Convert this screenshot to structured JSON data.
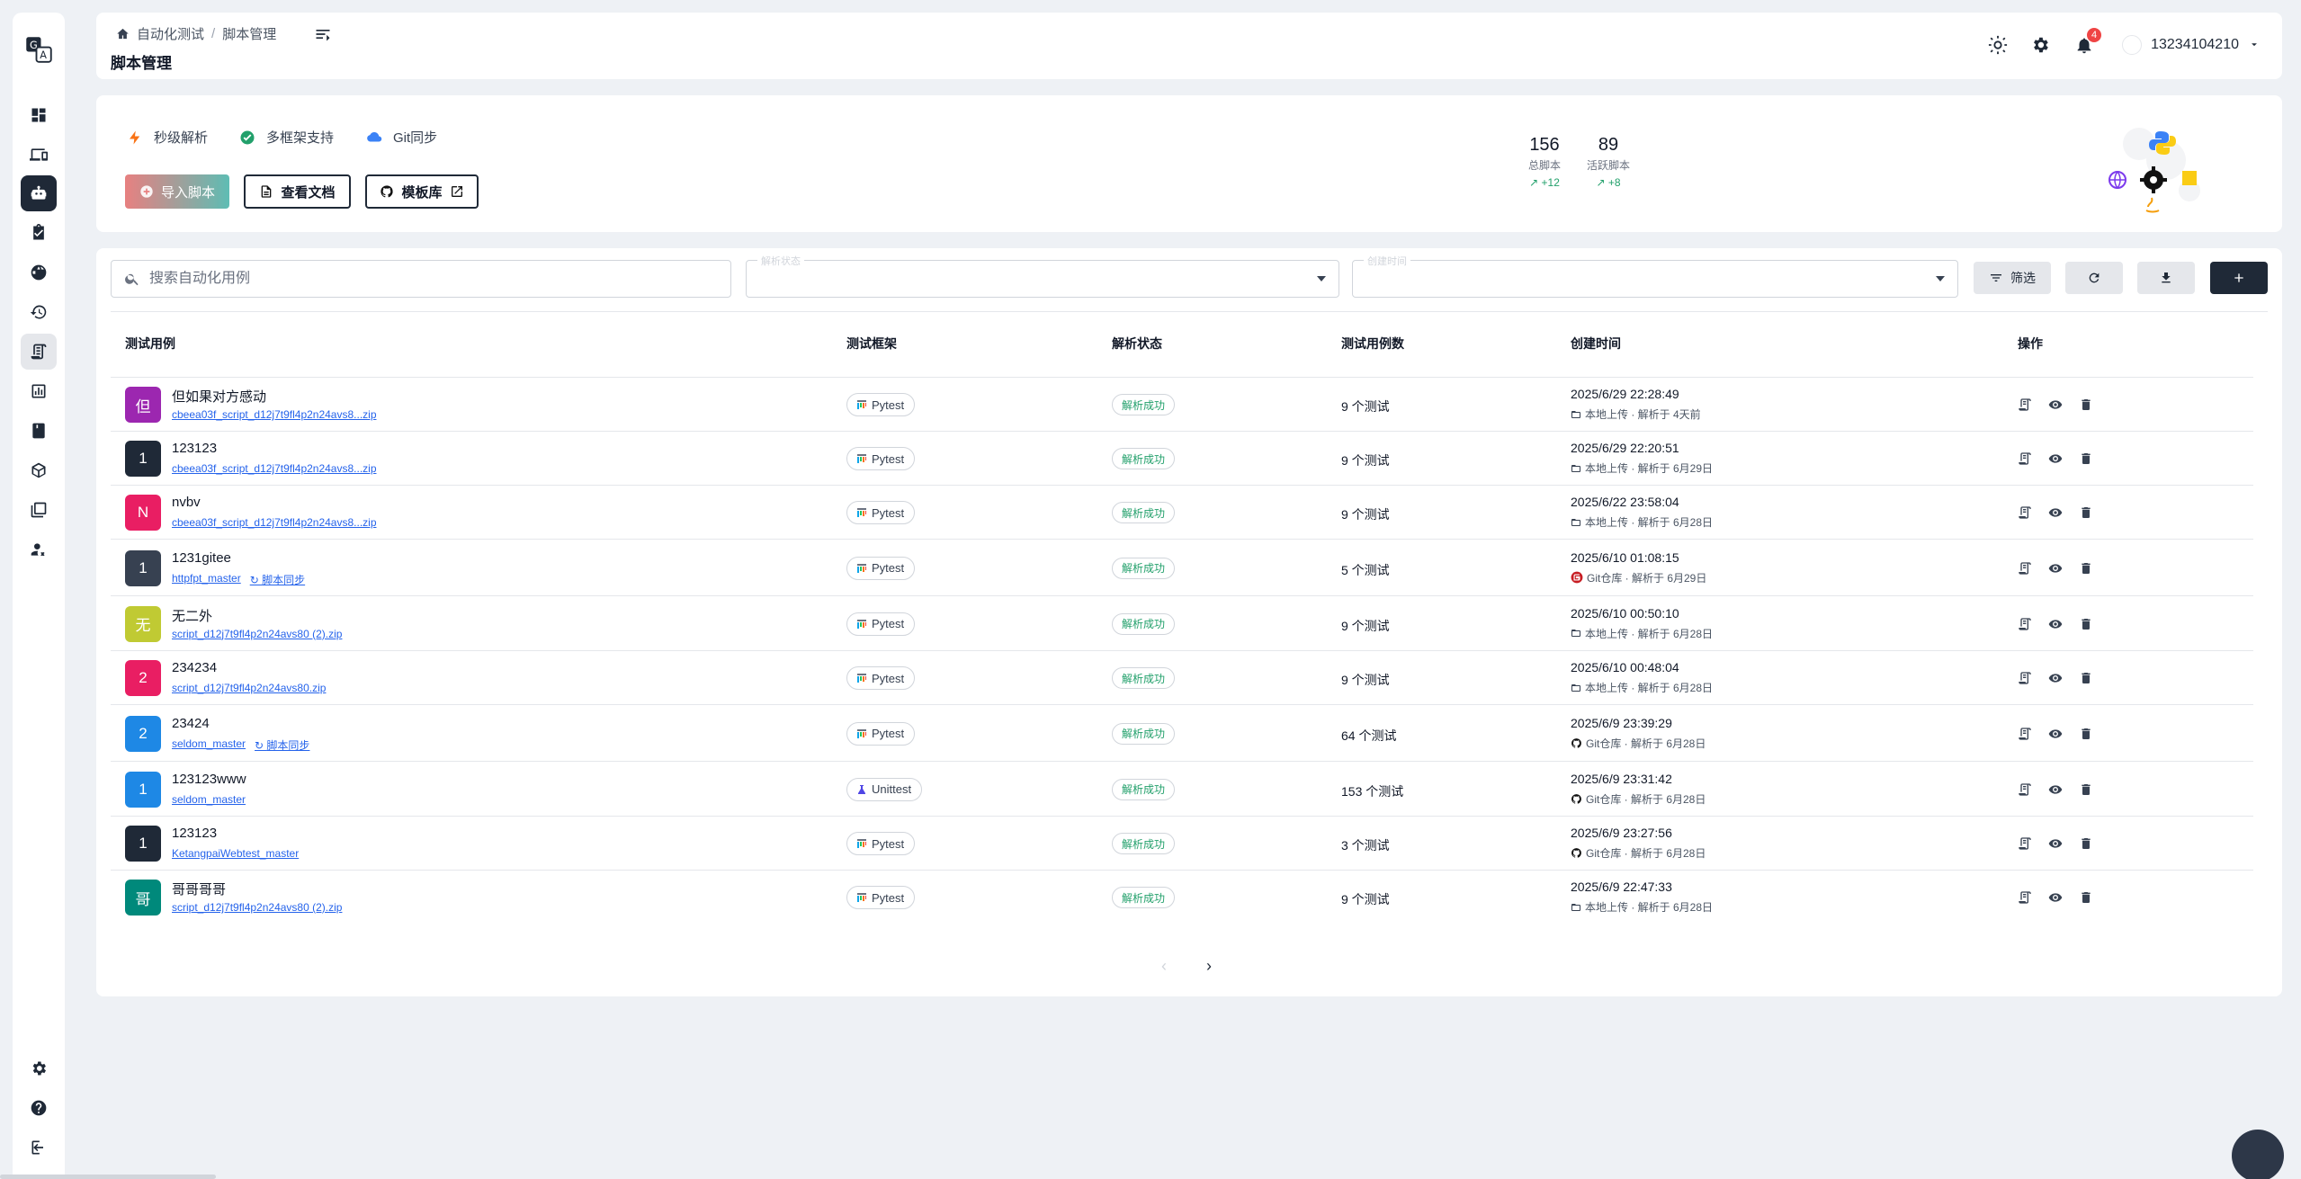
{
  "breadcrumb": {
    "parent": "自动化测试",
    "sep": "/",
    "current": "脚本管理"
  },
  "page_title": "脚本管理",
  "user": {
    "name": "13234104210",
    "notifications": "4"
  },
  "hero": {
    "features": [
      "秒级解析",
      "多框架支持",
      "Git同步"
    ],
    "buttons": {
      "import": "导入脚本",
      "docs": "查看文档",
      "templates": "模板库"
    },
    "stats": [
      {
        "num": "156",
        "label": "总脚本",
        "delta": "+12"
      },
      {
        "num": "89",
        "label": "活跃脚本",
        "delta": "+8"
      }
    ]
  },
  "toolbar": {
    "search_placeholder": "搜索自动化用例",
    "status_legend": "解析状态",
    "time_legend": "创建时间",
    "filter_label": "筛选"
  },
  "table": {
    "headers": [
      "测试用例",
      "测试框架",
      "解析状态",
      "测试用例数",
      "创建时间",
      "操作"
    ],
    "rows": [
      {
        "initial": "但",
        "color": "#9c27b0",
        "name": "但如果对方感动",
        "sub": "cbeea03f_script_d12j7t9fl4p2n24avs8...zip",
        "sync": "",
        "fw": "Pytest",
        "status": "解析成功",
        "count": "9 个测试",
        "date": "2025/6/29 22:28:49",
        "meta": "本地上传 · 解析于 4天前",
        "src": "local"
      },
      {
        "initial": "1",
        "color": "#1f2937",
        "name": "123123",
        "sub": "cbeea03f_script_d12j7t9fl4p2n24avs8...zip",
        "sync": "",
        "fw": "Pytest",
        "status": "解析成功",
        "count": "9 个测试",
        "date": "2025/6/29 22:20:51",
        "meta": "本地上传 · 解析于 6月29日",
        "src": "local"
      },
      {
        "initial": "N",
        "color": "#e91e63",
        "name": "nvbv",
        "sub": "cbeea03f_script_d12j7t9fl4p2n24avs8...zip",
        "sync": "",
        "fw": "Pytest",
        "status": "解析成功",
        "count": "9 个测试",
        "date": "2025/6/22 23:58:04",
        "meta": "本地上传 · 解析于 6月28日",
        "src": "local"
      },
      {
        "initial": "1",
        "color": "#374151",
        "name": "1231gitee",
        "sub": "httpfpt_master",
        "sync": "脚本同步",
        "fw": "Pytest",
        "status": "解析成功",
        "count": "5 个测试",
        "date": "2025/6/10 01:08:15",
        "meta": "Git仓库 · 解析于 6月29日",
        "src": "gitee"
      },
      {
        "initial": "无",
        "color": "#c0ca33",
        "name": "无二外",
        "sub": "script_d12j7t9fl4p2n24avs80 (2).zip",
        "sync": "",
        "fw": "Pytest",
        "status": "解析成功",
        "count": "9 个测试",
        "date": "2025/6/10 00:50:10",
        "meta": "本地上传 · 解析于 6月28日",
        "src": "local"
      },
      {
        "initial": "2",
        "color": "#e91e63",
        "name": "234234",
        "sub": "script_d12j7t9fl4p2n24avs80.zip",
        "sync": "",
        "fw": "Pytest",
        "status": "解析成功",
        "count": "9 个测试",
        "date": "2025/6/10 00:48:04",
        "meta": "本地上传 · 解析于 6月28日",
        "src": "local"
      },
      {
        "initial": "2",
        "color": "#1e88e5",
        "name": "23424",
        "sub": "seldom_master",
        "sync": "脚本同步",
        "fw": "Pytest",
        "status": "解析成功",
        "count": "64 个测试",
        "date": "2025/6/9 23:39:29",
        "meta": "Git仓库 · 解析于 6月28日",
        "src": "github"
      },
      {
        "initial": "1",
        "color": "#1e88e5",
        "name": "123123www",
        "sub": "seldom_master",
        "sync": "",
        "fw": "Unittest",
        "status": "解析成功",
        "count": "153 个测试",
        "date": "2025/6/9 23:31:42",
        "meta": "Git仓库 · 解析于 6月28日",
        "src": "github"
      },
      {
        "initial": "1",
        "color": "#1f2937",
        "name": "123123",
        "sub": "KetangpaiWebtest_master",
        "sync": "",
        "fw": "Pytest",
        "status": "解析成功",
        "count": "3 个测试",
        "date": "2025/6/9 23:27:56",
        "meta": "Git仓库 · 解析于 6月28日",
        "src": "github"
      },
      {
        "initial": "哥",
        "color": "#00897b",
        "name": "哥哥哥哥",
        "sub": "script_d12j7t9fl4p2n24avs80 (2).zip",
        "sync": "",
        "fw": "Pytest",
        "status": "解析成功",
        "count": "9 个测试",
        "date": "2025/6/9 22:47:33",
        "meta": "本地上传 · 解析于 6月28日",
        "src": "local"
      }
    ]
  },
  "pager": {
    "prev": "‹",
    "next": "›"
  }
}
